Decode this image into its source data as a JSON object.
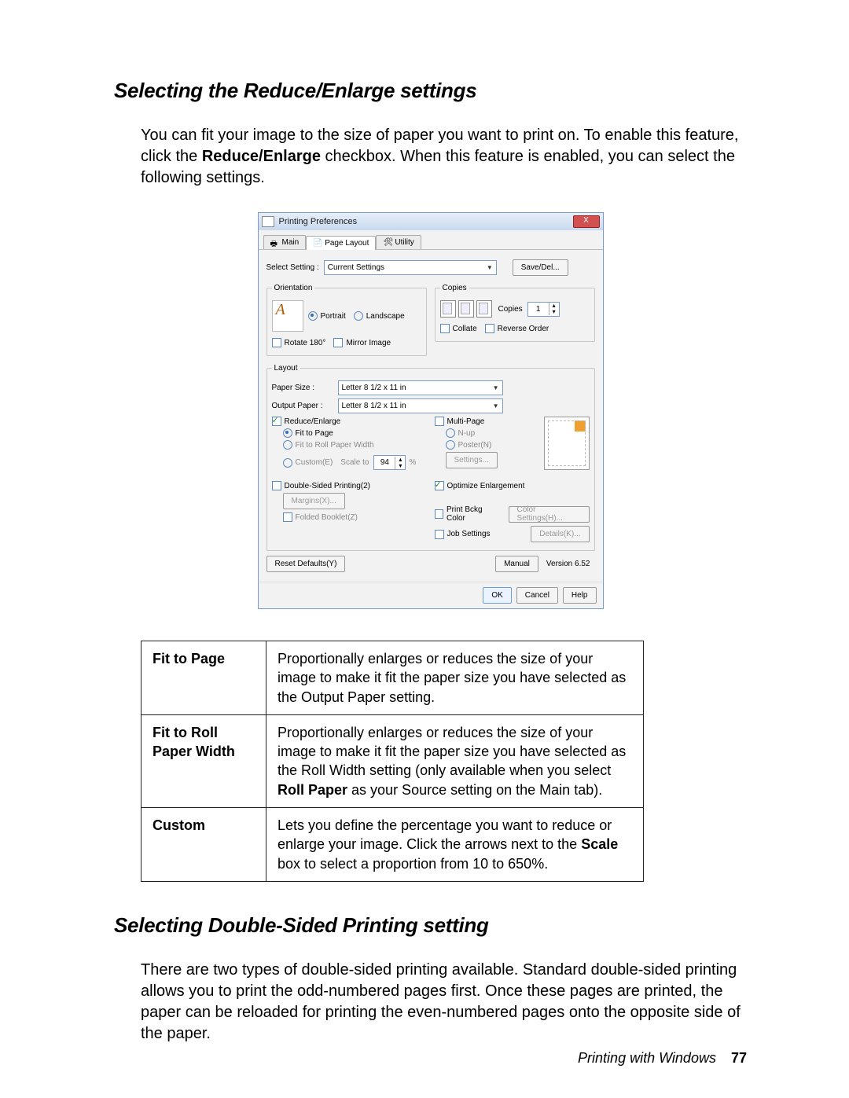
{
  "sections": {
    "reduce_enlarge": {
      "title": "Selecting the Reduce/Enlarge settings",
      "para_a": "You can fit your image to the size of paper you want to print on. To enable this feature, click the ",
      "para_bold": "Reduce/Enlarge",
      "para_b": " checkbox. When this feature is enabled, you can select the following settings."
    },
    "double_sided": {
      "title": "Selecting Double-Sided Printing setting",
      "para": "There are two types of double-sided printing available. Standard double-sided printing allows you to print the odd-numbered pages first. Once these pages are printed, the paper can be reloaded for printing the even-numbered pages onto the opposite side of the paper."
    }
  },
  "dialog": {
    "title": "Printing Preferences",
    "close": "X",
    "tabs": {
      "main": "Main",
      "page_layout": "Page Layout",
      "utility": "Utility"
    },
    "select_setting_lbl": "Select Setting :",
    "select_setting_val": "Current Settings",
    "save_del": "Save/Del...",
    "orientation": {
      "legend": "Orientation",
      "portrait": "Portrait",
      "landscape": "Landscape",
      "rotate": "Rotate 180°",
      "mirror": "Mirror Image"
    },
    "copies": {
      "legend": "Copies",
      "copies_lbl": "Copies",
      "copies_val": "1",
      "collate": "Collate",
      "reverse": "Reverse Order"
    },
    "layout": {
      "legend": "Layout",
      "paper_size_lbl": "Paper Size :",
      "paper_size_val": "Letter 8 1/2 x 11 in",
      "output_paper_lbl": "Output Paper :",
      "output_paper_val": "Letter 8 1/2 x 11 in",
      "reduce_enlarge": "Reduce/Enlarge",
      "fit_to_page": "Fit to Page",
      "fit_to_roll": "Fit to Roll Paper Width",
      "custom": "Custom(E)",
      "scale_to": "Scale to",
      "scale_val": "94",
      "pct": "%",
      "multi_page": "Multi-Page",
      "nup": "N-up",
      "poster": "Poster(N)",
      "settings_btn": "Settings...",
      "dsp": "Double-Sided Printing(2)",
      "margins": "Margins(X)...",
      "folded": "Folded Booklet(Z)",
      "opt_enl": "Optimize Enlargement",
      "print_bg": "Print Bckg Color",
      "color_settings": "Color Settings(H)...",
      "job_settings": "Job Settings",
      "details": "Details(K)..."
    },
    "reset": "Reset Defaults(Y)",
    "manual": "Manual",
    "version": "Version  6.52",
    "ok": "OK",
    "cancel": "Cancel",
    "help": "Help"
  },
  "table": {
    "r1k": "Fit to Page",
    "r1v": "Proportionally enlarges or reduces the size of your image to make it fit the paper size you have selected as the Output Paper setting.",
    "r2k": "Fit to Roll Paper Width",
    "r2v_a": "Proportionally enlarges or reduces the size of your image to make it fit the paper size you have selected as the Roll Width setting (only available when you select ",
    "r2v_bold": "Roll Paper",
    "r2v_b": " as your Source setting on the Main tab).",
    "r3k": "Custom",
    "r3v_a": "Lets you define the percentage you want to reduce or enlarge your image. Click the arrows next to the ",
    "r3v_bold": "Scale",
    "r3v_b": " box to select a proportion from 10 to 650%."
  },
  "footer": {
    "chapter": "Printing with Windows",
    "page": "77"
  }
}
